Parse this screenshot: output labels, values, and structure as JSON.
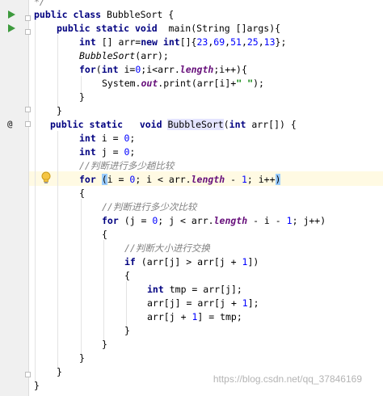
{
  "editor": {
    "lines": [
      "*/",
      "public class BubbleSort {",
      "public static void  main(String []args){",
      "int [] arr=new int[]{23,69,51,25,13};",
      "BubbleSort(arr);",
      "for(int i=0;i<arr.length;i++){",
      "System.out.print(arr[i]+\" \");",
      "}",
      "}",
      "public static   void BubbleSort(int arr[]) {",
      "int i = 0;",
      "int j = 0;",
      "//判断进行多少趟比较",
      "for (i = 0; i < arr.length - 1; i++)",
      "{",
      "//判断进行多少次比较",
      "for (j = 0; j < arr.length - i - 1; j++)",
      "{",
      "//判断大小进行交换",
      "if (arr[j] > arr[j + 1])",
      "{",
      "int tmp = arr[j];",
      "arr[j] = arr[j + 1];",
      "arr[j + 1] = tmp;",
      "}",
      "}",
      "}",
      "}",
      "}"
    ],
    "tokens": {
      "public": "public",
      "class": "class",
      "static": "static",
      "void": "void",
      "int": "int",
      "new": "new",
      "for": "for",
      "if": "if",
      "class_name": "BubbleSort",
      "main": "main",
      "string_type": "String",
      "args": "args",
      "arr": "arr",
      "i": "i",
      "j": "j",
      "tmp": "tmp",
      "length": "length",
      "system": "System",
      "out": "out",
      "print": "print",
      "space_string": "\" \"",
      "n0": "0",
      "n1": "1",
      "n23": "23",
      "n69": "69",
      "n51": "51",
      "n25": "25",
      "n13": "13",
      "comment_trips": "//判断进行多少趟比较",
      "comment_times": "//判断进行多少次比较",
      "comment_swap": "//判断大小进行交换",
      "comment_end": "*/"
    }
  },
  "gutter": {
    "icons": [
      "run-icon",
      "run-icon",
      "override-icon",
      "lightbulb-icon"
    ],
    "override_glyph": "@"
  },
  "colors": {
    "keyword": "#000080",
    "number": "#0000ff",
    "string": "#008000",
    "comment": "#808080",
    "field": "#660e7a",
    "run_icon": "#3d9a3d",
    "caret_line": "#fffae3",
    "identifier_highlight": "#e4e4ff",
    "brace_match": "#99ccff"
  },
  "watermark": {
    "text": "https://blog.csdn.net/qq_37846169"
  }
}
